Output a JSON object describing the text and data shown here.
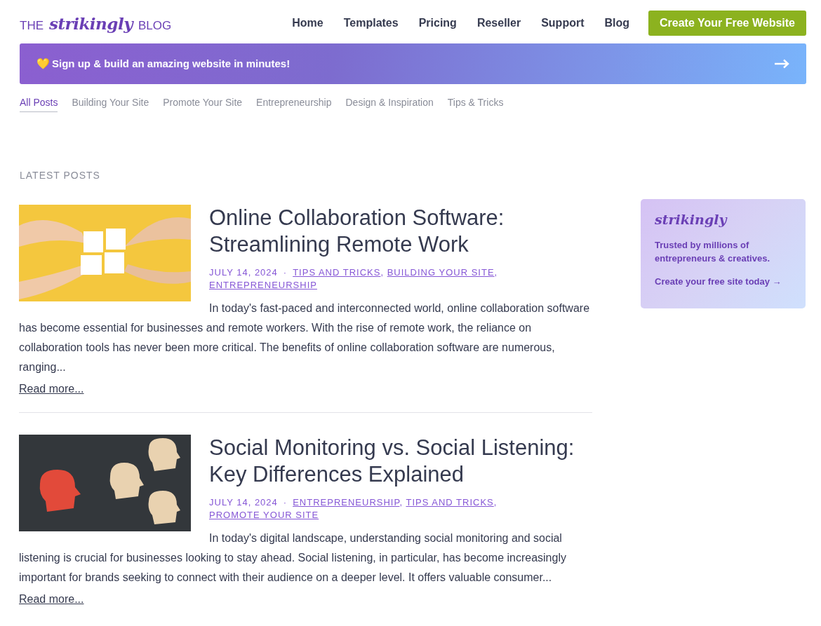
{
  "header": {
    "logo": {
      "prefix": "THE",
      "brand": "strikingly",
      "suffix": "BLOG"
    },
    "nav": [
      "Home",
      "Templates",
      "Pricing",
      "Reseller",
      "Support",
      "Blog"
    ],
    "cta": "Create Your Free Website"
  },
  "banner": {
    "emoji": "💛",
    "text": "Sign up & build an amazing website in minutes!"
  },
  "tabs": [
    {
      "label": "All Posts",
      "selected": true
    },
    {
      "label": "Building Your Site",
      "selected": false
    },
    {
      "label": "Promote Your Site",
      "selected": false
    },
    {
      "label": "Entrepreneurship",
      "selected": false
    },
    {
      "label": "Design & Inspiration",
      "selected": false
    },
    {
      "label": "Tips & Tricks",
      "selected": false
    }
  ],
  "section_title": "LATEST POSTS",
  "posts": [
    {
      "title": "Online Collaboration Software: Streamlining Remote Work",
      "meta": [
        {
          "kind": "date",
          "text": "JULY 14, 2024"
        },
        {
          "kind": "dot",
          "text": "·"
        },
        {
          "kind": "link",
          "text": "TIPS AND TRICKS"
        },
        {
          "kind": "comma",
          "text": ","
        },
        {
          "kind": "link",
          "text": "BUILDING YOUR SITE"
        },
        {
          "kind": "comma",
          "text": ","
        },
        {
          "kind": "link",
          "text": "ENTREPRENEURSHIP"
        }
      ],
      "excerpt": "In today's fast-paced and interconnected world, online collaboration software has become essential for businesses and remote workers. With the rise of remote work, the reliance on collaboration tools has never been more critical. The benefits of online collaboration software are numerous, ranging...",
      "read_more": "Read more..."
    },
    {
      "title": "Social Monitoring vs. Social Listening: Key Differences Explained",
      "meta": [
        {
          "kind": "date",
          "text": "JULY 14, 2024"
        },
        {
          "kind": "dot",
          "text": "·"
        },
        {
          "kind": "link",
          "text": "ENTREPRENEURSHIP"
        },
        {
          "kind": "comma",
          "text": ","
        },
        {
          "kind": "link",
          "text": "TIPS AND TRICKS"
        },
        {
          "kind": "comma",
          "text": ","
        },
        {
          "kind": "link",
          "text": "PROMOTE YOUR SITE"
        }
      ],
      "excerpt": "In today's digital landscape, understanding social monitoring and social listening is crucial for businesses looking to stay ahead. Social listening, in particular, has become increasingly important for brands seeking to connect with their audience on a deeper level. It offers valuable consumer...",
      "read_more": "Read more..."
    }
  ],
  "sidebar": {
    "brand": "strikingly",
    "tagline": "Trusted by millions of entrepreneurs & creatives.",
    "link": "Create your free site today →"
  }
}
